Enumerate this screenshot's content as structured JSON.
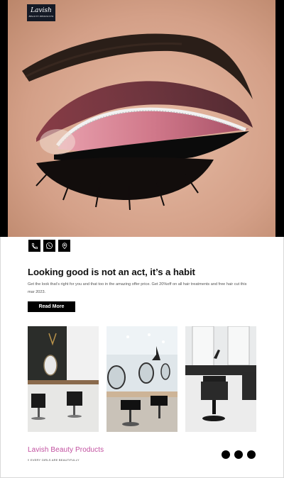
{
  "logo": {
    "name": "Lavish",
    "sub": "BEAUTY PRODUCTS"
  },
  "hero": {
    "image": "eye-makeup-photo"
  },
  "contact_icons": [
    "phone-icon",
    "whatsapp-icon",
    "location-pin-icon"
  ],
  "content": {
    "headline": "Looking good is not an act, it’s a habit",
    "description": "Get the look that’s right for you and that too in the amazing offer price. Get 20%off on all hair treatments and free hair cut this mar 2023.",
    "cta_label": "Read More"
  },
  "gallery": [
    "salon-interior-dark",
    "salon-interior-bright",
    "salon-interior-chair"
  ],
  "footer": {
    "brand": "Lavish Beauty Products",
    "tagline": "!! EVERY GIRLS ARE BEAUTIFULLY",
    "dot_count": 3
  },
  "colors": {
    "brand_pink": "#c14f9f",
    "button_bg": "#000000"
  }
}
